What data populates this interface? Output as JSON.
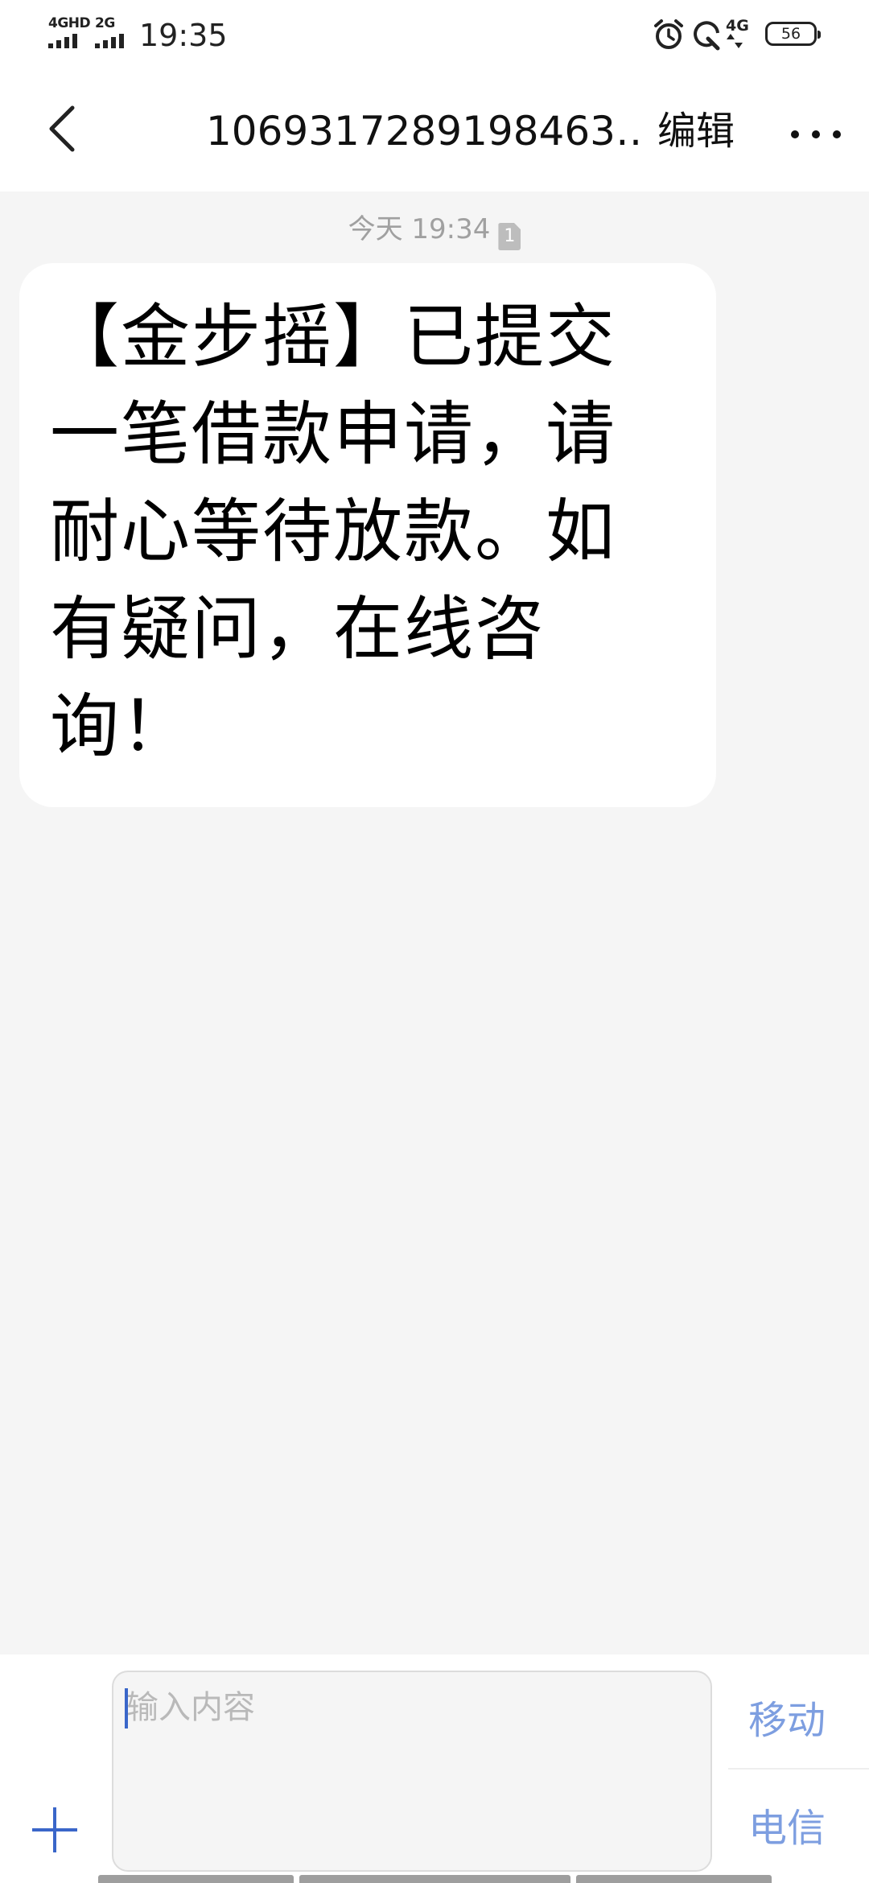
{
  "status_bar": {
    "sim1_label": "4GHD",
    "sim2_label": "2G",
    "time": "19:35",
    "network_label": "4G",
    "battery_level": "56",
    "icons": [
      "alarm-icon",
      "data-saver-icon",
      "network-4g-icon",
      "battery-icon"
    ]
  },
  "header": {
    "title": "1069317289198463…",
    "edit_label": "编辑",
    "icons": [
      "back-icon",
      "more-icon"
    ]
  },
  "conversation": {
    "timestamp": "今天 19:34",
    "sim_badge": "1",
    "messages": [
      {
        "direction": "incoming",
        "text": "【金步摇】已提交一笔借款申请，请耐心等待放款。如有疑问，在线咨询！"
      }
    ]
  },
  "composer": {
    "placeholder": "输入内容",
    "send_sim1_label": "移动",
    "send_sim2_label": "电信",
    "icons": [
      "add-icon"
    ]
  },
  "colors": {
    "accent": "#3a66c9",
    "send_text": "#7d9ee0",
    "background": "#f5f5f5",
    "bubble": "#ffffff"
  }
}
